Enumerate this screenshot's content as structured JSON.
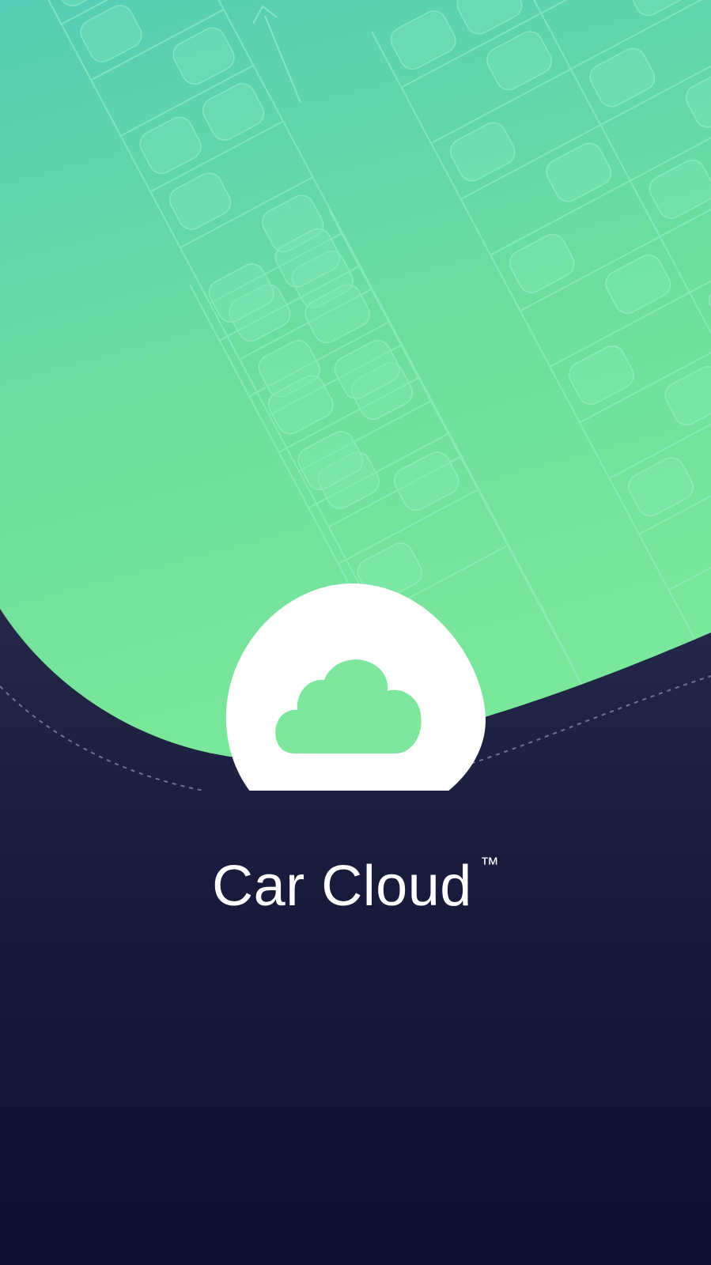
{
  "app": {
    "name": "Car Cloud",
    "trademark": "™"
  },
  "logo": {
    "icon": "cloud-icon",
    "badge_color": "#ffffff",
    "cloud_color": "#7de79c"
  },
  "colors": {
    "hero_green_top": "#5ad3b3",
    "hero_green_bottom": "#7ae69a",
    "background_top": "#363d63",
    "background_bottom": "#0e1130"
  }
}
